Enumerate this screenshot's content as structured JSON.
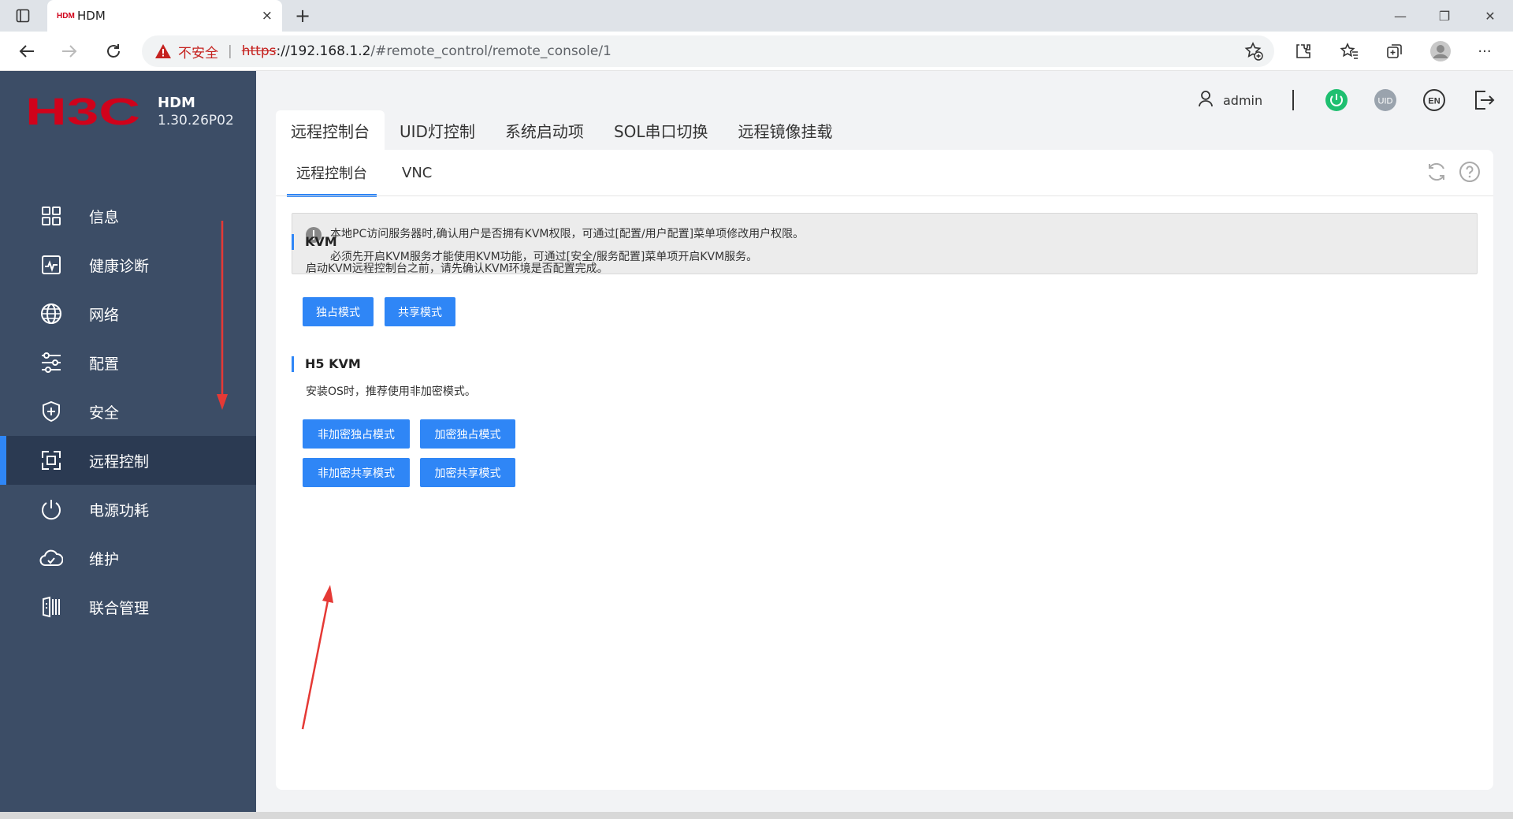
{
  "browser": {
    "tab_favicon": "HDM",
    "tab_title": "HDM",
    "tab_close": "×",
    "new_tab": "+",
    "insecure_label": "不安全",
    "separator": "|",
    "url_scheme": "https",
    "url_host": "://192.168.1.2",
    "url_path": "/#remote_control/remote_console/1",
    "min": "—",
    "restore": "❐",
    "close": "✕",
    "more": "···"
  },
  "brand": {
    "logo_text": "H3C",
    "logo_color": "#d0021b",
    "product_name": "HDM",
    "version": "1.30.26P02"
  },
  "sidebar": {
    "items": [
      {
        "label": "信息",
        "icon": "grid-icon"
      },
      {
        "label": "健康诊断",
        "icon": "pulse-icon"
      },
      {
        "label": "网络",
        "icon": "globe-icon"
      },
      {
        "label": "配置",
        "icon": "sliders-icon"
      },
      {
        "label": "安全",
        "icon": "shield-icon"
      },
      {
        "label": "远程控制",
        "icon": "remote-icon",
        "active": true
      },
      {
        "label": "电源功耗",
        "icon": "power-icon"
      },
      {
        "label": "维护",
        "icon": "cloud-icon"
      },
      {
        "label": "联合管理",
        "icon": "server-rack-icon"
      }
    ]
  },
  "header": {
    "username": "admin",
    "uid_label": "UID",
    "lang_label": "EN",
    "power_color": "#1fbf70"
  },
  "main_tabs": [
    "远程控制台",
    "UID灯控制",
    "系统启动项",
    "SOL串口切换",
    "远程镜像挂载"
  ],
  "sub_tabs": [
    "远程控制台",
    "VNC"
  ],
  "notice": {
    "line1": "本地PC访问服务器时,确认用户是否拥有KVM权限，可通过[配置/用户配置]菜单项修改用户权限。",
    "line2": "必须先开启KVM服务才能使用KVM功能，可通过[安全/服务配置]菜单项开启KVM服务。"
  },
  "kvm": {
    "title": "KVM",
    "desc": "启动KVM远程控制台之前，请先确认KVM环境是否配置完成。",
    "btn_exclusive": "独占模式",
    "btn_shared": "共享模式"
  },
  "h5kvm": {
    "title": "H5 KVM",
    "desc": "安装OS时，推荐使用非加密模式。",
    "btn_plain_exclusive": "非加密独占模式",
    "btn_enc_exclusive": "加密独占模式",
    "btn_plain_shared": "非加密共享模式",
    "btn_enc_shared": "加密共享模式"
  },
  "colors": {
    "accent": "#2f86f6",
    "sidebar_bg": "#3c4d66",
    "annotation_arrow": "#e53935"
  }
}
